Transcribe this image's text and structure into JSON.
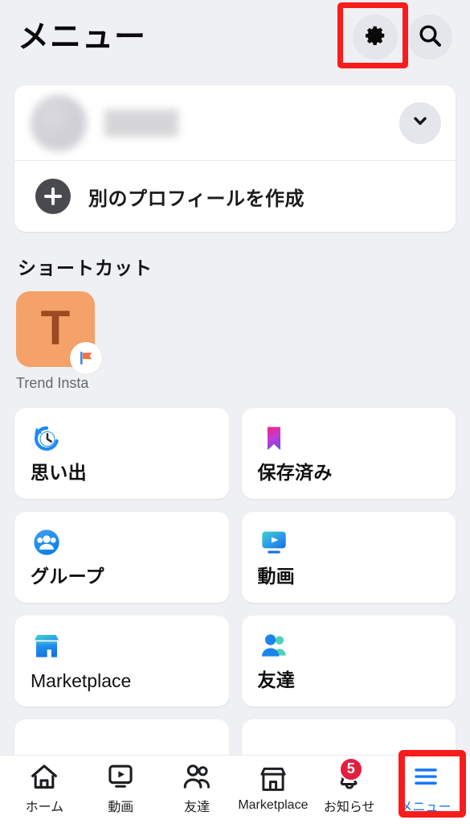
{
  "header": {
    "title": "メニュー",
    "settings_icon": "gear-icon",
    "search_icon": "search-icon"
  },
  "profile": {
    "name": "",
    "name_redacted": true,
    "avatar_redacted": true,
    "expand_icon": "chevron-down-icon",
    "create_profile_label": "別のプロフィールを作成",
    "create_profile_icon": "plus-icon"
  },
  "shortcuts": {
    "section_title": "ショートカット",
    "items": [
      {
        "label": "Trend Insta",
        "initial": "T",
        "tile_color": "#f4a16a",
        "letter_color": "#9c4a22",
        "badge_icon": "page-flag-icon"
      }
    ]
  },
  "tiles": [
    {
      "label": "思い出",
      "icon": "memories-clock-icon",
      "latin": false
    },
    {
      "label": "保存済み",
      "icon": "saved-bookmark-icon",
      "latin": false
    },
    {
      "label": "グループ",
      "icon": "groups-icon",
      "latin": false
    },
    {
      "label": "動画",
      "icon": "video-monitor-icon",
      "latin": false
    },
    {
      "label": "Marketplace",
      "icon": "marketplace-storefront-icon",
      "latin": true
    },
    {
      "label": "友達",
      "icon": "friends-people-icon",
      "latin": false
    }
  ],
  "bottom_nav": {
    "items": [
      {
        "label": "ホーム",
        "icon": "home-icon",
        "active": false,
        "badge": ""
      },
      {
        "label": "動画",
        "icon": "video-icon",
        "active": false,
        "badge": ""
      },
      {
        "label": "友達",
        "icon": "friends-icon",
        "active": false,
        "badge": ""
      },
      {
        "label": "Marketplace",
        "icon": "marketplace-icon",
        "active": false,
        "badge": ""
      },
      {
        "label": "お知らせ",
        "icon": "bell-icon",
        "active": false,
        "badge": "5"
      },
      {
        "label": "メニュー",
        "icon": "hamburger-menu-icon",
        "active": true,
        "badge": ""
      }
    ]
  },
  "annotations": {
    "highlight_color": "#f81c1c",
    "gear_highlight_target": "settings-button",
    "menu_highlight_target": "nav-item-menu"
  },
  "colors": {
    "page_background": "#eef0f3",
    "card_background": "#ffffff",
    "accent_blue": "#1877f2",
    "badge_red": "#e41e3f",
    "muted_text": "#65676b"
  }
}
